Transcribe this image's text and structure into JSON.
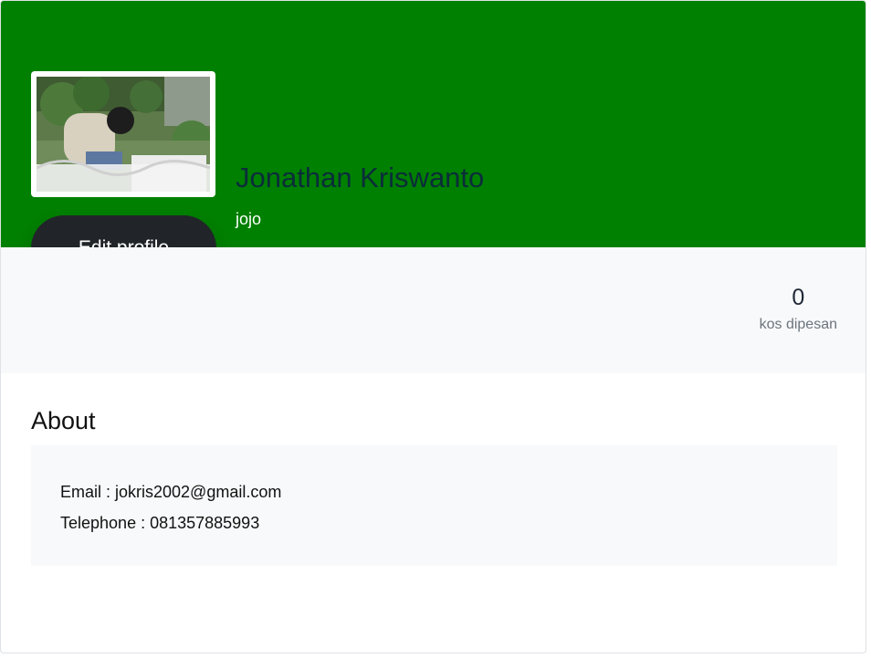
{
  "profile": {
    "name": "Jonathan Kriswanto",
    "username": "jojo",
    "edit_label": "Edit profile",
    "avatar_alt": "profile photo"
  },
  "stats": {
    "booked_count": "0",
    "booked_label": "kos dipesan"
  },
  "about": {
    "title": "About",
    "email_line": "Email : jokris2002@gmail.com",
    "phone_line": "Telephone : 081357885993"
  },
  "colors": {
    "cover": "#008000",
    "button": "#212529",
    "strip": "#f8f9fa"
  }
}
